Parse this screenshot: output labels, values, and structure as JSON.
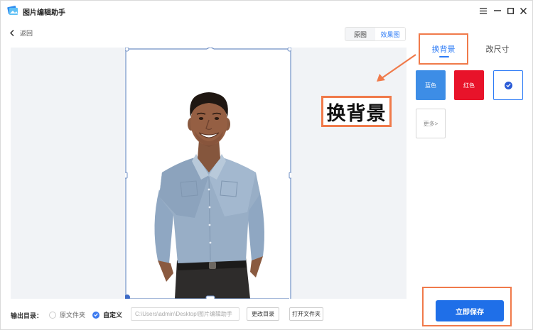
{
  "app": {
    "title": "图片编辑助手"
  },
  "nav": {
    "back_label": "返回"
  },
  "view_toggle": {
    "original": "原图",
    "result": "效果图",
    "active": "result"
  },
  "annotation": {
    "label": "换背景"
  },
  "panel": {
    "tabs": [
      {
        "label": "换背景",
        "active": true
      },
      {
        "label": "改尺寸",
        "active": false
      }
    ],
    "colors": [
      {
        "label": "蓝色",
        "color": "#3d8de6"
      },
      {
        "label": "红色",
        "color": "#e8132a"
      },
      {
        "label": "",
        "color": "#ffffff",
        "selected": true
      }
    ],
    "more_label": "更多>"
  },
  "bottom": {
    "output_label": "输出目录：",
    "radio_original": "原文件夹",
    "radio_custom": "自定义",
    "path_value": "C:\\Users\\admin\\Desktop\\图片编辑助手",
    "change_dir_label": "更改目录",
    "open_folder_label": "打开文件夹",
    "save_label": "立即保存"
  },
  "colors": {
    "accent": "#2e7cf6",
    "highlight": "#f07a4a",
    "save_button": "#1f6fe8"
  }
}
